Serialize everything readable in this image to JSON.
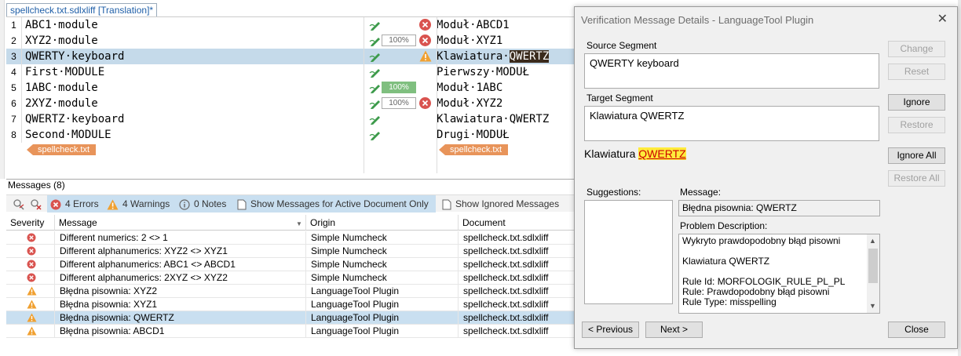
{
  "editor": {
    "tab_label": "spellcheck.txt.sdlxliff [Translation]*",
    "segments": [
      {
        "num": "1",
        "source": "ABC1·module",
        "target": "Moduł·ABCD1",
        "percent": "",
        "status": "error"
      },
      {
        "num": "2",
        "source": "XYZ2·module",
        "target": "Moduł·XYZ1",
        "percent": "100%",
        "status": "error"
      },
      {
        "num": "3",
        "source": "QWERTY·keyboard",
        "target_prefix": "Klawiatura·",
        "target_highlight": "QWERTZ",
        "percent": "",
        "status": "warning"
      },
      {
        "num": "4",
        "source": "First·MODULE",
        "target": "Pierwszy·MODUŁ",
        "percent": "",
        "status": ""
      },
      {
        "num": "5",
        "source": "1ABC·module",
        "target": "Moduł·1ABC",
        "percent": "100%",
        "status": "",
        "percent_green": true
      },
      {
        "num": "6",
        "source": "2XYZ·module",
        "target": "Moduł·XYZ2",
        "percent": "100%",
        "status": "error"
      },
      {
        "num": "7",
        "source": "QWERTZ·keyboard",
        "target": "Klawiatura·QWERTZ",
        "percent": "",
        "status": ""
      },
      {
        "num": "8",
        "source": "Second·MODULE",
        "target": "Drugi·MODUŁ",
        "percent": "",
        "status": ""
      }
    ],
    "doc_tag_source": "spellcheck.txt",
    "doc_tag_target": "spellcheck.txt"
  },
  "messages": {
    "title": "Messages (8)",
    "toolbar": {
      "errors": "4 Errors",
      "warnings": "4 Warnings",
      "notes": "0 Notes",
      "active_doc": "Show Messages for Active Document Only",
      "ignored": "Show Ignored Messages"
    },
    "columns": [
      "Severity",
      "Message",
      "Origin",
      "Document"
    ],
    "rows": [
      {
        "severity": "error",
        "message": "Different numerics: 2 <> 1",
        "origin": "Simple Numcheck",
        "document": "spellcheck.txt.sdlxliff"
      },
      {
        "severity": "error",
        "message": "Different alphanumerics: XYZ2 <> XYZ1",
        "origin": "Simple Numcheck",
        "document": "spellcheck.txt.sdlxliff"
      },
      {
        "severity": "error",
        "message": "Different alphanumerics: ABC1 <> ABCD1",
        "origin": "Simple Numcheck",
        "document": "spellcheck.txt.sdlxliff"
      },
      {
        "severity": "error",
        "message": "Different alphanumerics: 2XYZ <> XYZ2",
        "origin": "Simple Numcheck",
        "document": "spellcheck.txt.sdlxliff"
      },
      {
        "severity": "warning",
        "message": "Błędna pisownia: XYZ2",
        "origin": "LanguageTool Plugin",
        "document": "spellcheck.txt.sdlxliff"
      },
      {
        "severity": "warning",
        "message": "Błędna pisownia: XYZ1",
        "origin": "LanguageTool Plugin",
        "document": "spellcheck.txt.sdlxliff"
      },
      {
        "severity": "warning",
        "message": "Błędna pisownia: QWERTZ",
        "origin": "LanguageTool Plugin",
        "document": "spellcheck.txt.sdlxliff",
        "selected": true
      },
      {
        "severity": "warning",
        "message": "Błędna pisownia: ABCD1",
        "origin": "LanguageTool Plugin",
        "document": "spellcheck.txt.sdlxliff"
      }
    ]
  },
  "dialog": {
    "title": "Verification Message Details - LanguageTool Plugin",
    "source_label": "Source Segment",
    "source_text": "QWERTY keyboard",
    "target_label": "Target Segment",
    "target_text": "Klawiatura QWERTZ",
    "preview_prefix": "Klawiatura ",
    "preview_highlight": "QWERTZ",
    "suggestions_label": "Suggestions:",
    "message_label": "Message:",
    "message_text": "Błędna pisownia: QWERTZ",
    "problem_label": "Problem Description:",
    "problem_lines": [
      "Wykryto prawdopodobny błąd pisowni",
      "",
      "Klawiatura QWERTZ",
      "",
      "Rule Id: MORFOLOGIK_RULE_PL_PL",
      "Rule: Prawdopodobny błąd pisowni",
      "Rule Type: misspelling"
    ],
    "buttons": {
      "change": "Change",
      "reset": "Reset",
      "ignore": "Ignore",
      "restore": "Restore",
      "ignore_all": "Ignore All",
      "restore_all": "Restore All",
      "previous": "< Previous",
      "next": "Next >",
      "close": "Close"
    }
  },
  "colors": {
    "error": "#d9534f",
    "warning": "#f0a030",
    "selection": "#c5daea",
    "doc_tag": "#e8945a",
    "accent": "#1f5fa8"
  }
}
